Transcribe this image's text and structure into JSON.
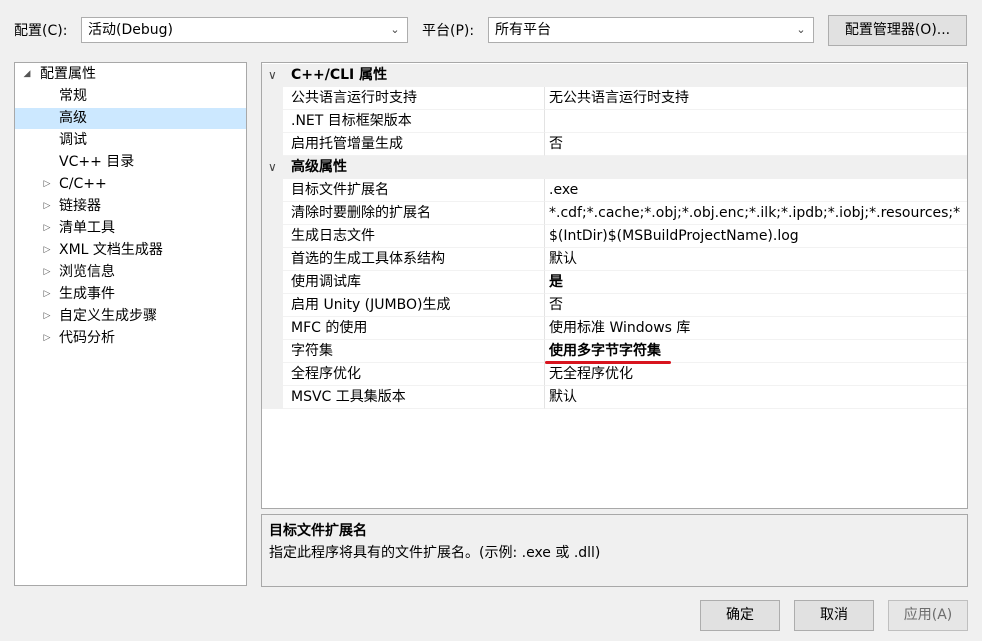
{
  "config_bar": {
    "config_label": "配置(C):",
    "config_value": "活动(Debug)",
    "platform_label": "平台(P):",
    "platform_value": "所有平台",
    "manager_button": "配置管理器(O)..."
  },
  "tree": {
    "root": "配置属性",
    "items": [
      {
        "label": "常规",
        "expandable": false,
        "selected": false
      },
      {
        "label": "高级",
        "expandable": false,
        "selected": true
      },
      {
        "label": "调试",
        "expandable": false,
        "selected": false
      },
      {
        "label": "VC++ 目录",
        "expandable": false,
        "selected": false
      },
      {
        "label": "C/C++",
        "expandable": true,
        "selected": false
      },
      {
        "label": "链接器",
        "expandable": true,
        "selected": false
      },
      {
        "label": "清单工具",
        "expandable": true,
        "selected": false
      },
      {
        "label": "XML 文档生成器",
        "expandable": true,
        "selected": false
      },
      {
        "label": "浏览信息",
        "expandable": true,
        "selected": false
      },
      {
        "label": "生成事件",
        "expandable": true,
        "selected": false
      },
      {
        "label": "自定义生成步骤",
        "expandable": true,
        "selected": false
      },
      {
        "label": "代码分析",
        "expandable": true,
        "selected": false
      }
    ]
  },
  "grid": {
    "categories": [
      {
        "title": "C++/CLI 属性",
        "rows": [
          {
            "name": "公共语言运行时支持",
            "value": "无公共语言运行时支持",
            "bold": false
          },
          {
            "name": ".NET 目标框架版本",
            "value": "",
            "bold": false
          },
          {
            "name": "启用托管增量生成",
            "value": "否",
            "bold": false
          }
        ]
      },
      {
        "title": "高级属性",
        "rows": [
          {
            "name": "目标文件扩展名",
            "value": ".exe",
            "bold": false
          },
          {
            "name": "清除时要删除的扩展名",
            "value": "*.cdf;*.cache;*.obj;*.obj.enc;*.ilk;*.ipdb;*.iobj;*.resources;*",
            "bold": false
          },
          {
            "name": "生成日志文件",
            "value": "$(IntDir)$(MSBuildProjectName).log",
            "bold": false
          },
          {
            "name": "首选的生成工具体系结构",
            "value": "默认",
            "bold": false
          },
          {
            "name": "使用调试库",
            "value": "是",
            "bold": true
          },
          {
            "name": "启用 Unity (JUMBO)生成",
            "value": "否",
            "bold": false
          },
          {
            "name": "MFC 的使用",
            "value": "使用标准 Windows 库",
            "bold": false
          },
          {
            "name": "字符集",
            "value": "使用多字节字符集",
            "bold": true
          },
          {
            "name": "全程序优化",
            "value": "无全程序优化",
            "bold": false
          },
          {
            "name": "MSVC 工具集版本",
            "value": "默认",
            "bold": false
          }
        ]
      }
    ]
  },
  "description": {
    "title": "目标文件扩展名",
    "text": "指定此程序将具有的文件扩展名。(示例: .exe 或 .dll)"
  },
  "buttons": {
    "ok": "确定",
    "cancel": "取消",
    "apply": "应用(A)"
  },
  "colors": {
    "selection": "#cce8ff",
    "highlight_underline": "#d8141e",
    "disabled_text": "#6d6d6d"
  },
  "icons": {
    "expanded": "triangle-down-icon",
    "collapsed": "triangle-right-icon",
    "dropdown": "chevron-down-icon"
  }
}
